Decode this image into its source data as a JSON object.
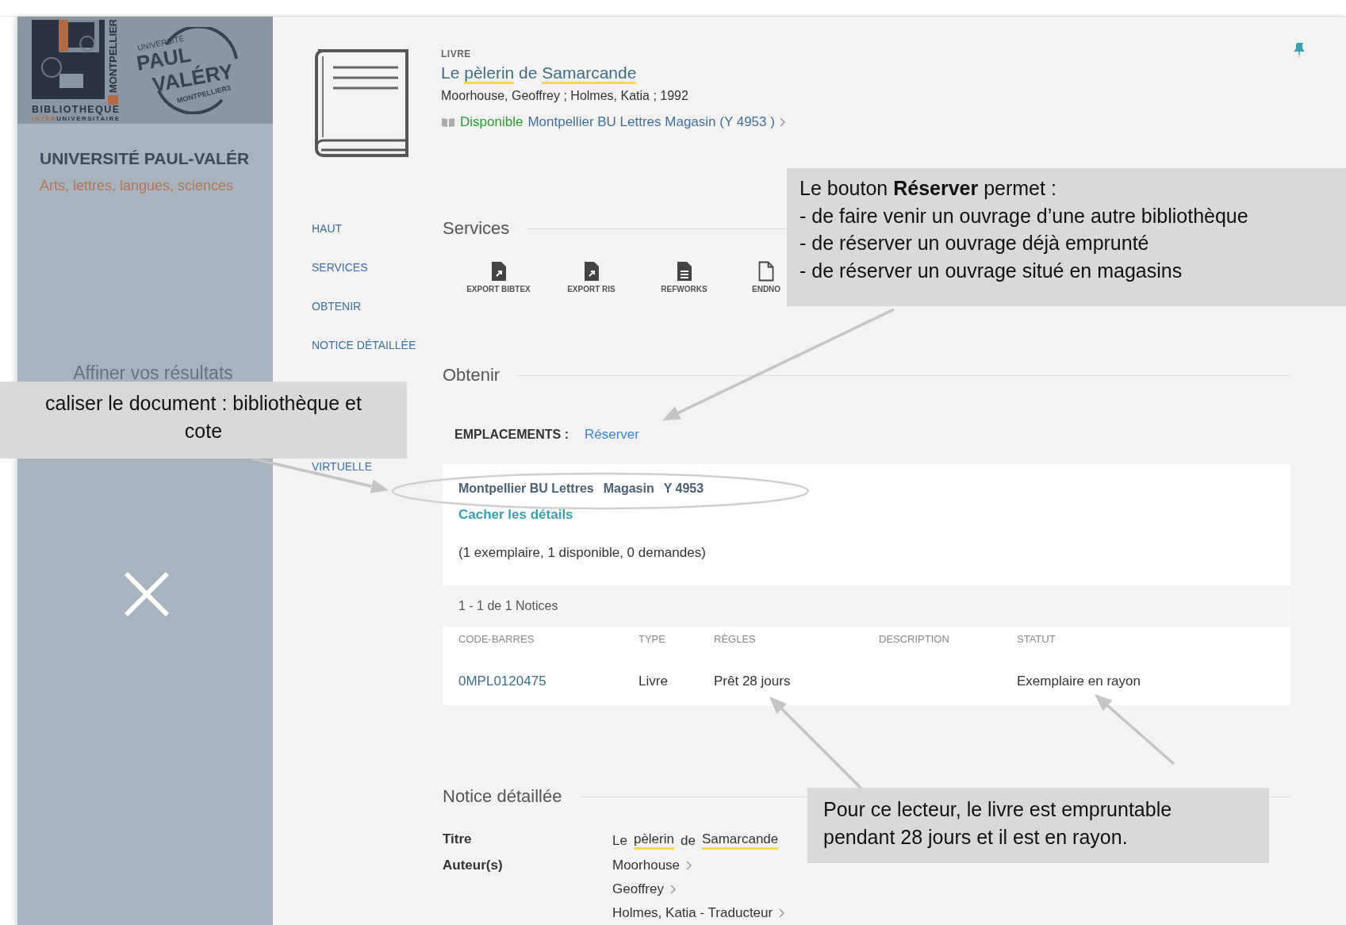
{
  "sidebar": {
    "library_logo": {
      "side": "MONTPELLIER",
      "line_1": "BIBLIOTHEQUE",
      "line_2_accent": "INTER",
      "line_2": "UNIVERSITAIRE"
    },
    "university_logo": {
      "top": "UNIVERSITÉ",
      "line_1": "PAUL",
      "line_2": "VALÉRY",
      "bottom": "MONTPELLIER3"
    },
    "title": "UNIVERSITÉ PAUL-VALÉR",
    "subtitle": "Arts, lettres, langues, sciences",
    "refine_heading": "Affiner vos résultats"
  },
  "record": {
    "type": "LIVRE",
    "title_parts": [
      {
        "text": "Le ",
        "highlight": false
      },
      {
        "text": "pèlerin",
        "highlight": true
      },
      {
        "text": " de ",
        "highlight": false
      },
      {
        "text": "Samarcande",
        "highlight": true
      }
    ],
    "authors": "Moorhouse, Geoffrey ; Holmes, Katia ; 1992",
    "availability": {
      "status": "Disponible",
      "location": "Montpellier BU Lettres  Magasin (Y 4953 )"
    }
  },
  "nav": [
    "HAUT",
    "SERVICES",
    "OBTENIR",
    "NOTICE DÉTAILLÉE",
    "VIRTUELLE"
  ],
  "services": {
    "heading": "Services",
    "actions": [
      {
        "label": "EXPORT BIBTEX",
        "kind": "export"
      },
      {
        "label": "EXPORT RIS",
        "kind": "export"
      },
      {
        "label": "REFWORKS",
        "kind": "document"
      },
      {
        "label": "ENDNO",
        "kind": "blank"
      }
    ]
  },
  "obtain": {
    "heading": "Obtenir",
    "locations_label": "EMPLACEMENTS :",
    "reserve_link": "Réserver",
    "holding": {
      "library": "Montpellier BU Lettres",
      "location": "Magasin",
      "call_number": "Y 4953",
      "toggle": "Cacher les détails",
      "summary": "(1 exemplaire, 1 disponible, 0 demandes)"
    },
    "items_count": "1 - 1 de 1 Notices",
    "table": {
      "columns": [
        "CODE-BARRES",
        "TYPE",
        "RÈGLES",
        "DESCRIPTION",
        "STATUT"
      ],
      "rows": [
        [
          "0MPL0120475",
          "Livre",
          "Prêt 28 jours",
          "",
          "Exemplaire en rayon"
        ]
      ]
    }
  },
  "details": {
    "heading": "Notice détaillée",
    "fields": [
      {
        "label": "Titre",
        "kind": "title",
        "parts": [
          {
            "text": "Le ",
            "highlight": false
          },
          {
            "text": "pèlerin",
            "highlight": true
          },
          {
            "text": " de ",
            "highlight": false
          },
          {
            "text": "Samarcande",
            "highlight": true
          }
        ]
      },
      {
        "label": "Auteur(s)",
        "kind": "links",
        "values": [
          "Moorhouse",
          "Geoffrey",
          "Holmes, Katia - Traducteur"
        ]
      }
    ]
  },
  "callouts": [
    {
      "kind": "reserve",
      "lines": [
        "Le bouton **Réserver** permet :",
        "- de faire venir un ouvrage d’une autre bibliothèque",
        "- de réserver un ouvrage déjà emprunté",
        "- de réserver un ouvrage situé en magasins"
      ]
    },
    {
      "kind": "location",
      "lines": [
        "caliser le document : bibliothèque et",
        "cote"
      ]
    },
    {
      "kind": "loan",
      "lines": [
        "Pour ce lecteur, le livre est empruntable",
        "pendant 28 jours et il est en rayon."
      ]
    }
  ]
}
